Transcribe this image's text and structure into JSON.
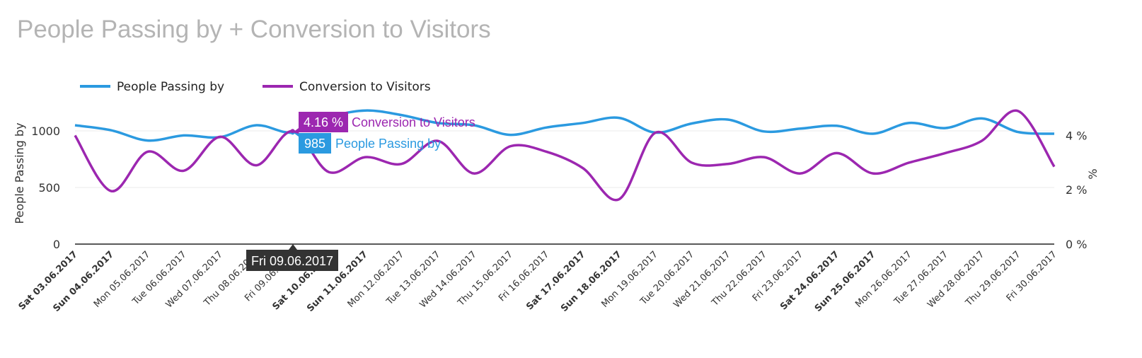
{
  "title": "People Passing by + Conversion to Visitors",
  "chart_data": {
    "type": "line",
    "title": "People Passing by + Conversion to Visitors",
    "categories": [
      "Sat 03.06.2017",
      "Sun 04.06.2017",
      "Mon 05.06.2017",
      "Tue 06.06.2017",
      "Wed 07.06.2017",
      "Thu 08.06.2017",
      "Fri 09.06.2017",
      "Sat 10.06.2017",
      "Sun 11.06.2017",
      "Mon 12.06.2017",
      "Tue 13.06.2017",
      "Wed 14.06.2017",
      "Thu 15.06.2017",
      "Fri 16.06.2017",
      "Sat 17.06.2017",
      "Sun 18.06.2017",
      "Mon 19.06.2017",
      "Tue 20.06.2017",
      "Wed 21.06.2017",
      "Thu 22.06.2017",
      "Fri 23.06.2017",
      "Sat 24.06.2017",
      "Sun 25.06.2017",
      "Mon 26.06.2017",
      "Tue 27.06.2017",
      "Wed 28.06.2017",
      "Thu 29.06.2017",
      "Fri 30.06.2017"
    ],
    "bold_categories": [
      "Sat 03.06.2017",
      "Sun 04.06.2017",
      "Sat 10.06.2017",
      "Sun 11.06.2017",
      "Sat 17.06.2017",
      "Sun 18.06.2017",
      "Sat 24.06.2017",
      "Sun 25.06.2017"
    ],
    "series": [
      {
        "name": "People Passing by",
        "axis": "left",
        "color": "#2b9ae0",
        "values": [
          1050,
          1005,
          915,
          960,
          945,
          1050,
          985,
          1120,
          1180,
          1140,
          1070,
          1050,
          965,
          1030,
          1070,
          1115,
          985,
          1065,
          1100,
          995,
          1020,
          1045,
          975,
          1070,
          1025,
          1110,
          990,
          975
        ]
      },
      {
        "name": "Conversion to Visitors",
        "axis": "right",
        "color": "#9c27b0",
        "values": [
          4.0,
          1.95,
          3.4,
          2.7,
          3.95,
          2.9,
          4.16,
          2.65,
          3.2,
          2.95,
          3.8,
          2.6,
          3.6,
          3.4,
          2.8,
          1.65,
          4.1,
          3.0,
          2.95,
          3.2,
          2.6,
          3.35,
          2.6,
          3.0,
          3.35,
          3.8,
          4.9,
          2.85
        ]
      }
    ],
    "y_left": {
      "label": "People Passing by",
      "ticks": [
        "0",
        "500",
        "1000"
      ],
      "range": [
        0,
        1200
      ]
    },
    "y_right": {
      "label": "%",
      "ticks": [
        "0 %",
        "2 %",
        "4 %"
      ],
      "range": [
        0,
        5
      ]
    },
    "grid": true,
    "legend_position": "top-left"
  },
  "tooltip": {
    "category": "Fri 09.06.2017",
    "conversion_value": "4.16 %",
    "conversion_label": "Conversion to Visitors",
    "people_value": "985",
    "people_label": "People Passing by"
  }
}
